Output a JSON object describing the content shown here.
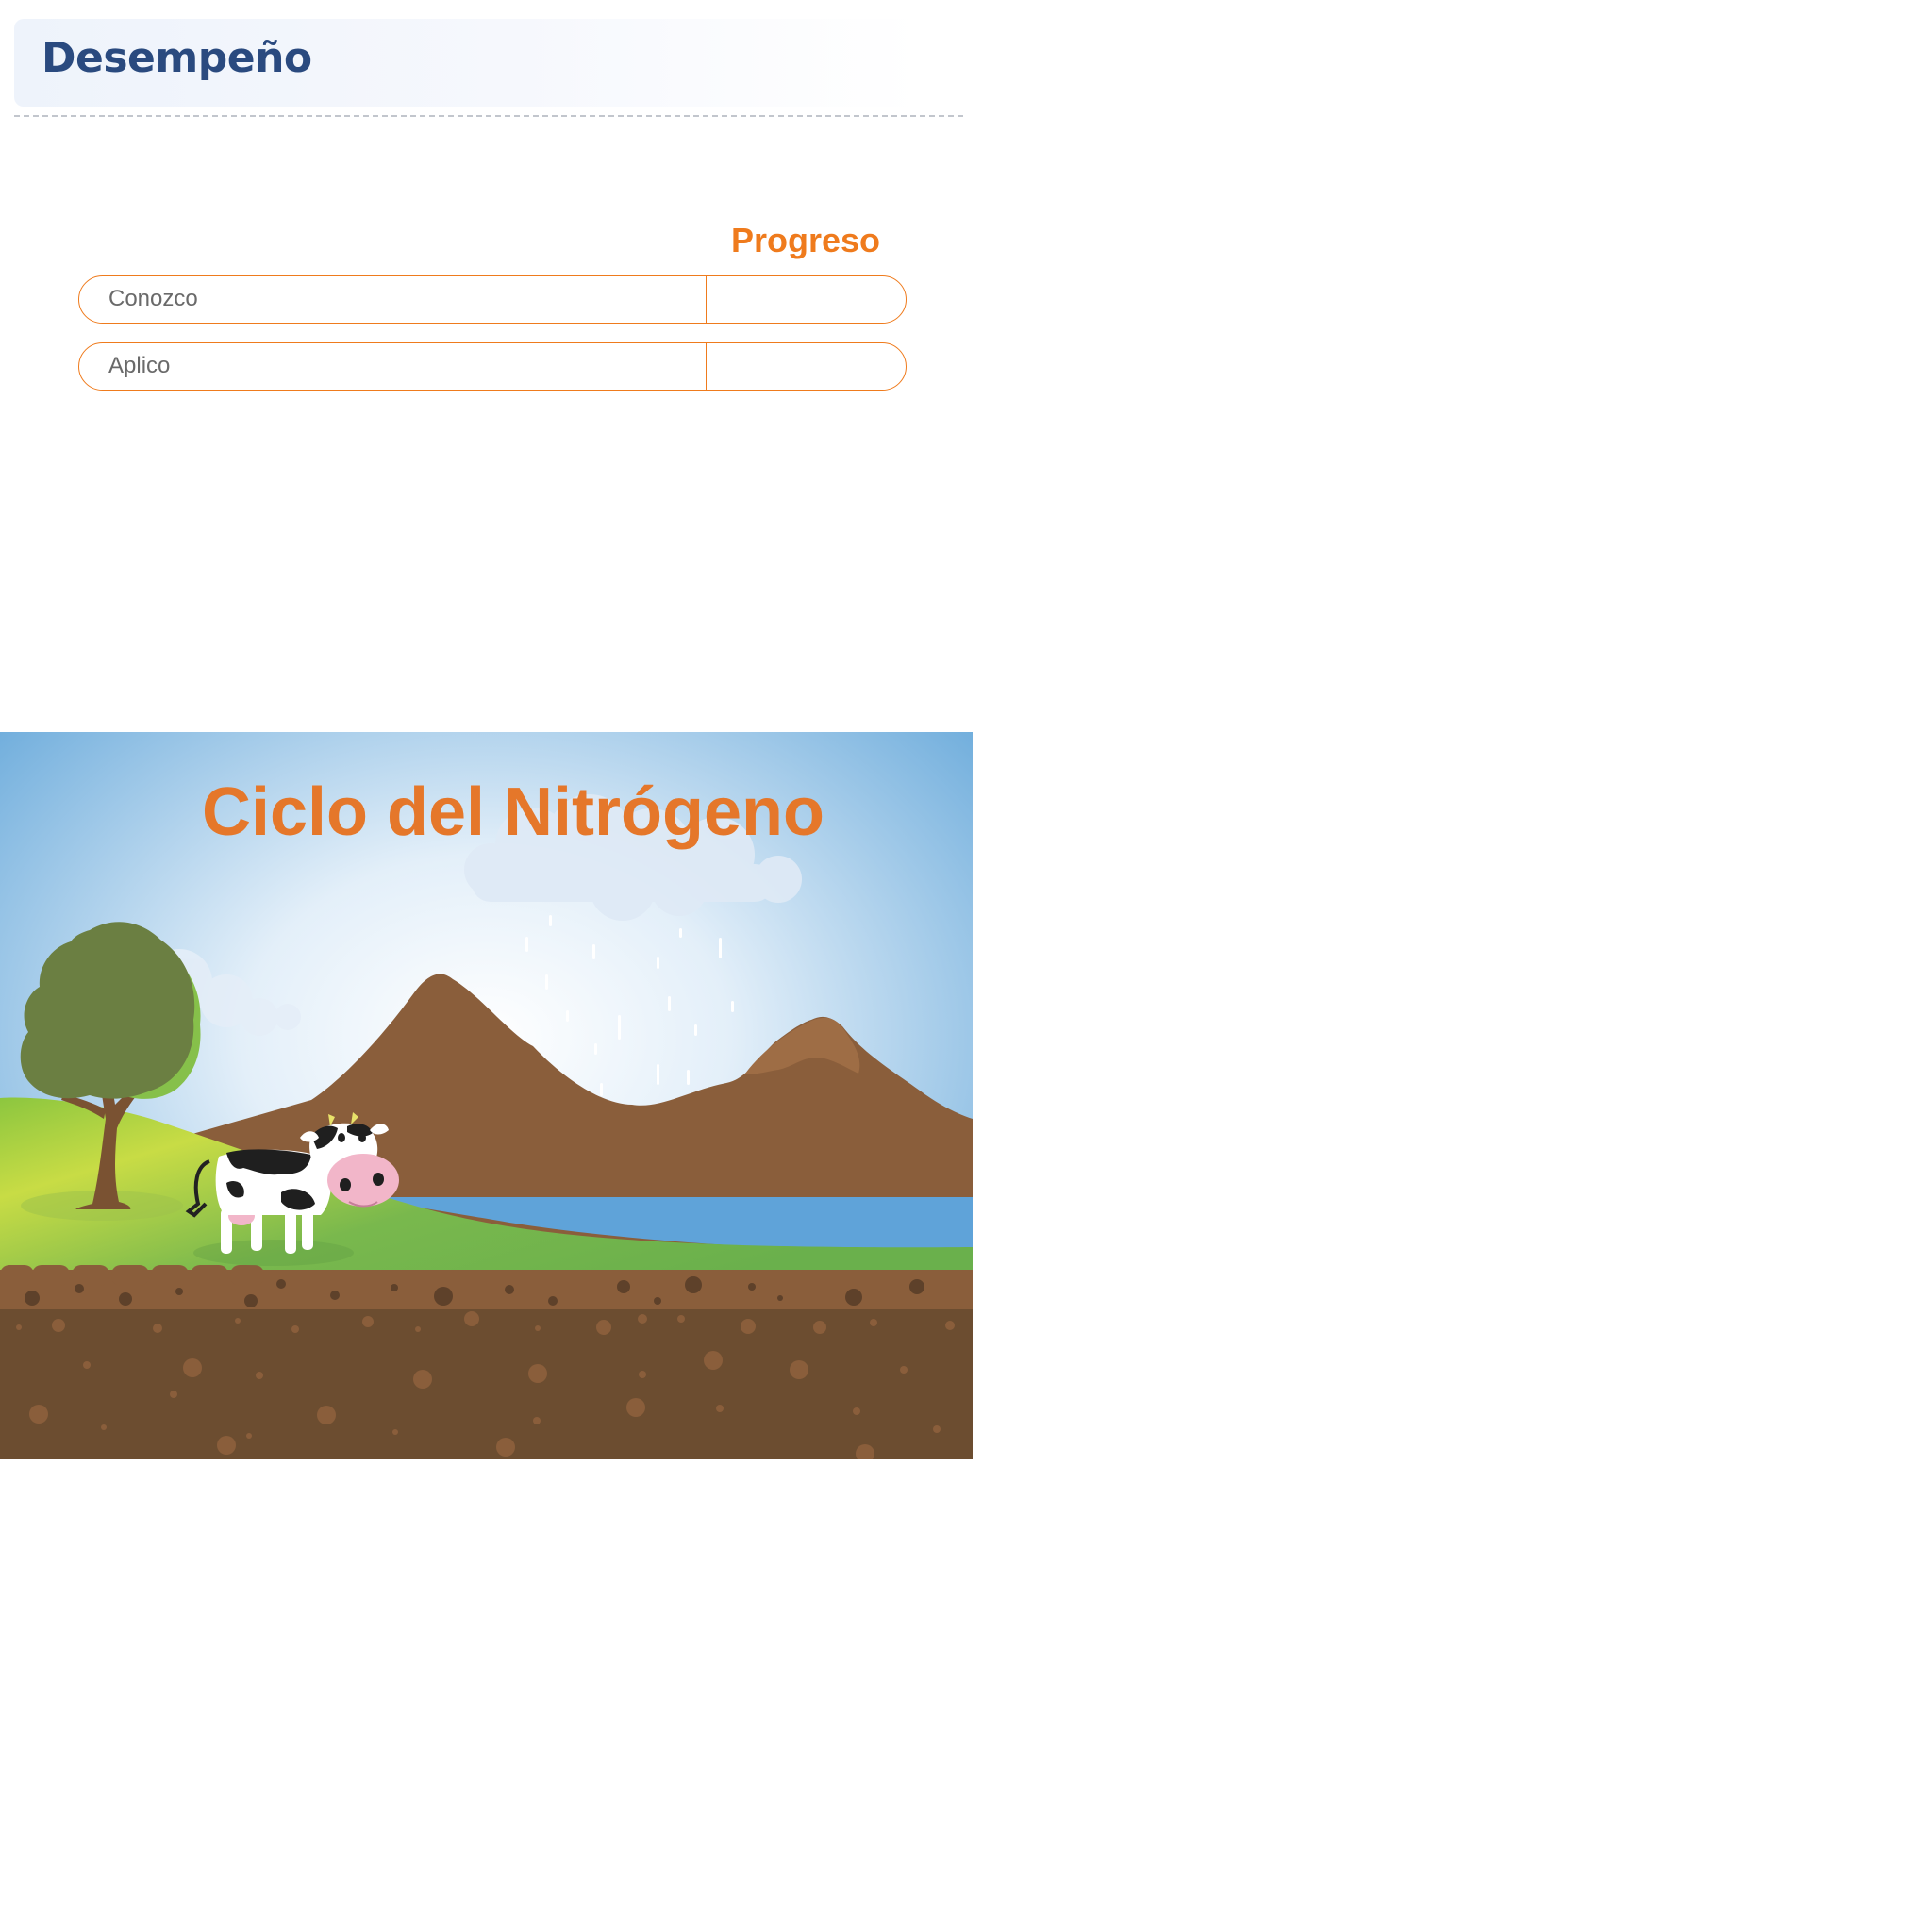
{
  "header": {
    "title": "Desempeño"
  },
  "progress": {
    "heading": "Progreso",
    "rows": [
      {
        "label": "Conozco",
        "value": ""
      },
      {
        "label": "Aplico",
        "value": ""
      }
    ]
  },
  "illustration": {
    "title": "Ciclo del Nitrógeno",
    "elements": [
      "sky",
      "cloud",
      "rain",
      "mountains",
      "tree",
      "cow",
      "lake",
      "grass",
      "soil"
    ]
  },
  "colors": {
    "header_title": "#2a4a7f",
    "accent_orange": "#ef7b1d",
    "illustration_title": "#e5772a",
    "sky": "#5fa4d8",
    "mountain": "#8a5e3b",
    "lake": "#5fa3d9",
    "grass": "#7dbb4e",
    "soil": "#6c4d30"
  }
}
